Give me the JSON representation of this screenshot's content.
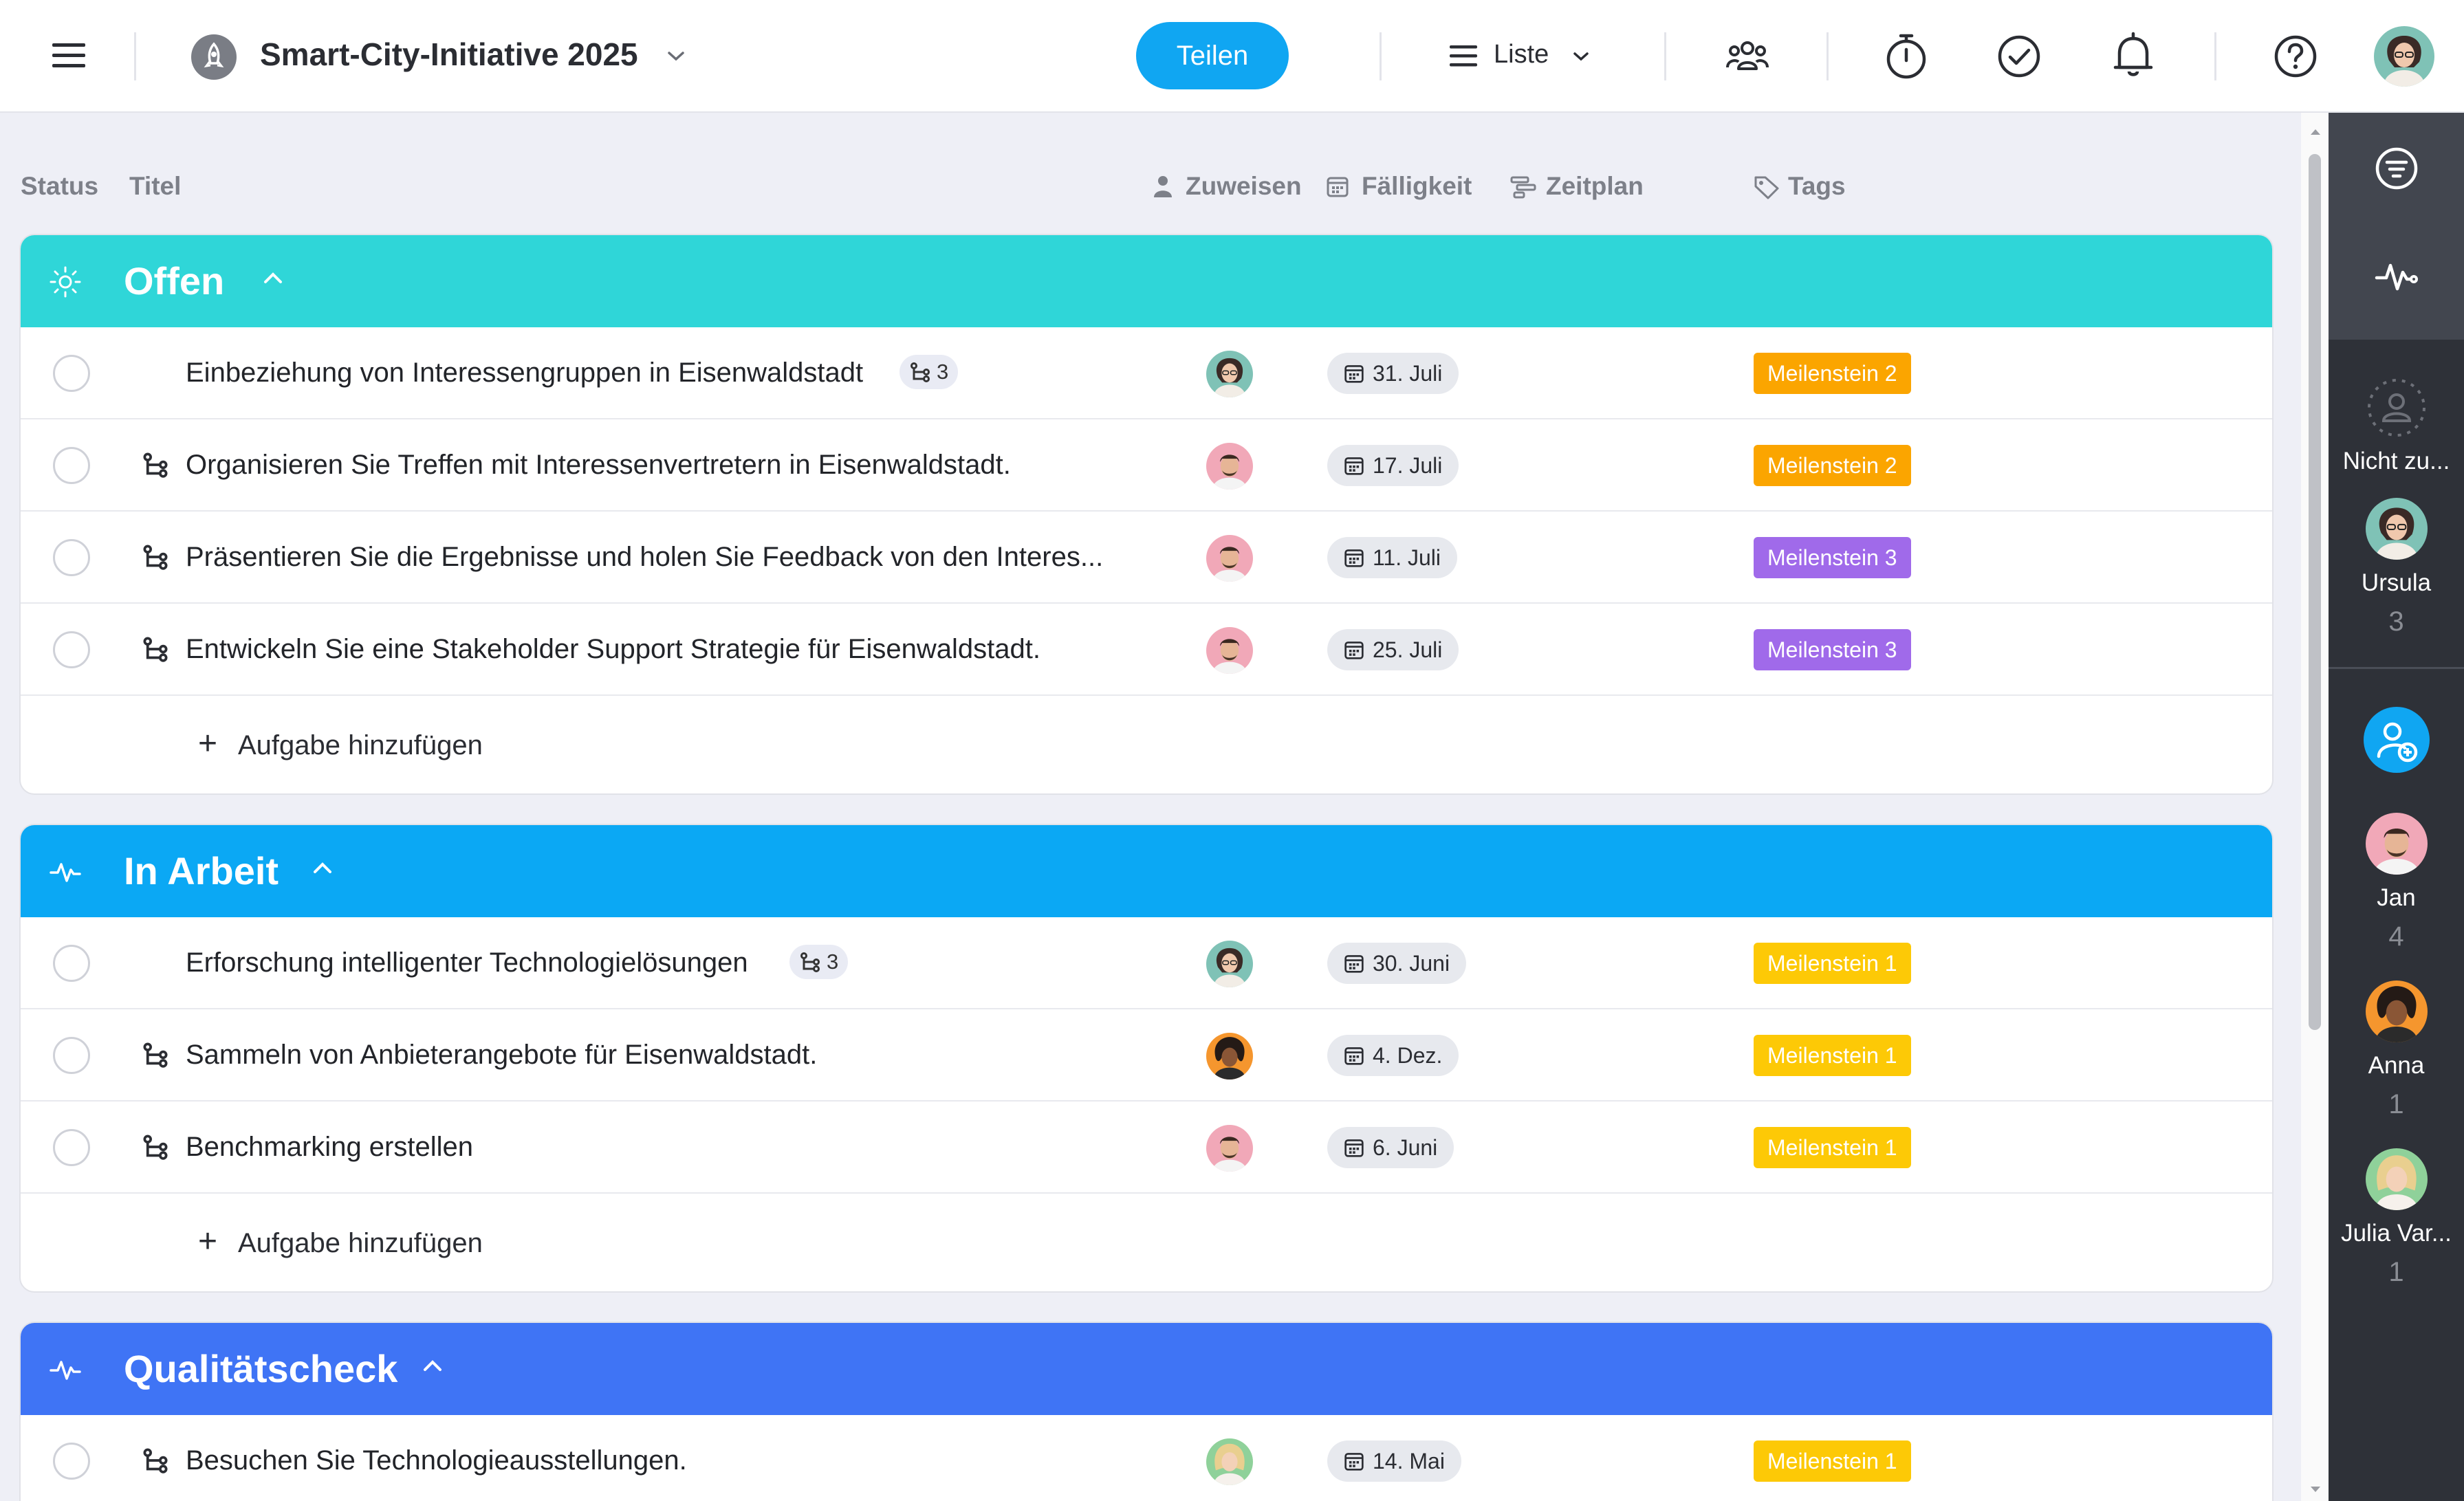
{
  "topbar": {
    "project_title": "Smart-City-Initiative 2025",
    "share_label": "Teilen",
    "view_label": "Liste",
    "icons": [
      "menu-icon",
      "rocket-icon",
      "chevron-down-icon",
      "list-icon",
      "team-icon",
      "timer-icon",
      "check-circle-icon",
      "bell-icon",
      "help-icon"
    ]
  },
  "columns": {
    "status": "Status",
    "title": "Titel",
    "assign": "Zuweisen",
    "due": "Fälligkeit",
    "schedule": "Zeitplan",
    "tags": "Tags"
  },
  "colors": {
    "offen": "#2fd6d8",
    "in_arbeit": "#0ba8f4",
    "qualitaetscheck": "#3f74f5",
    "tag_orange": "#fba500",
    "tag_purple": "#a06aea",
    "tag_yellow": "#fdc906",
    "share": "#10a6f2"
  },
  "groups": [
    {
      "title": "Offen",
      "icon": "sun-icon",
      "add_label": "Aufgabe hinzufügen",
      "tasks": [
        {
          "title": "Einbeziehung von Interessengruppen in Eisenwaldstadt",
          "subtasks": "3",
          "is_subtask": false,
          "avatar": "Ursula",
          "date": "31. Juli",
          "tag": "Meilenstein 2",
          "tag_color": "orange"
        },
        {
          "title": "Organisieren Sie Treffen mit Interessenvertretern in Eisenwaldstadt.",
          "is_subtask": true,
          "avatar": "Jan",
          "date": "17. Juli",
          "tag": "Meilenstein 2",
          "tag_color": "orange"
        },
        {
          "title": "Präsentieren Sie die Ergebnisse und holen Sie Feedback von den Interes...",
          "is_subtask": true,
          "avatar": "Jan",
          "date": "11. Juli",
          "tag": "Meilenstein 3",
          "tag_color": "purple"
        },
        {
          "title": "Entwickeln Sie eine Stakeholder Support Strategie für Eisenwaldstadt.",
          "is_subtask": true,
          "avatar": "Jan",
          "date": "25. Juli",
          "tag": "Meilenstein 3",
          "tag_color": "purple"
        }
      ]
    },
    {
      "title": "In Arbeit",
      "icon": "activity-icon",
      "add_label": "Aufgabe hinzufügen",
      "tasks": [
        {
          "title": "Erforschung intelligenter Technologielösungen",
          "subtasks": "3",
          "is_subtask": false,
          "avatar": "Ursula",
          "date": "30. Juni",
          "tag": "Meilenstein 1",
          "tag_color": "yellow"
        },
        {
          "title": "Sammeln von Anbieterangebote für Eisenwaldstadt.",
          "is_subtask": true,
          "avatar": "Anna",
          "date": "4. Dez.",
          "tag": "Meilenstein 1",
          "tag_color": "yellow"
        },
        {
          "title": "Benchmarking erstellen",
          "is_subtask": true,
          "avatar": "Jan",
          "date": "6. Juni",
          "tag": "Meilenstein 1",
          "tag_color": "yellow"
        }
      ]
    },
    {
      "title": "Qualitätscheck",
      "icon": "activity-icon",
      "tasks": [
        {
          "title": "Besuchen Sie Technologieausstellungen.",
          "is_subtask": true,
          "avatar": "Julia",
          "date": "14. Mai",
          "tag": "Meilenstein 1",
          "tag_color": "yellow"
        }
      ]
    }
  ],
  "sidebar": {
    "unassigned_label": "Nicht zu...",
    "people": [
      {
        "name": "Ursula",
        "count": "3"
      },
      {
        "name": "Jan",
        "count": "4"
      },
      {
        "name": "Anna",
        "count": "1"
      },
      {
        "name": "Julia Var...",
        "count": "1"
      }
    ]
  }
}
